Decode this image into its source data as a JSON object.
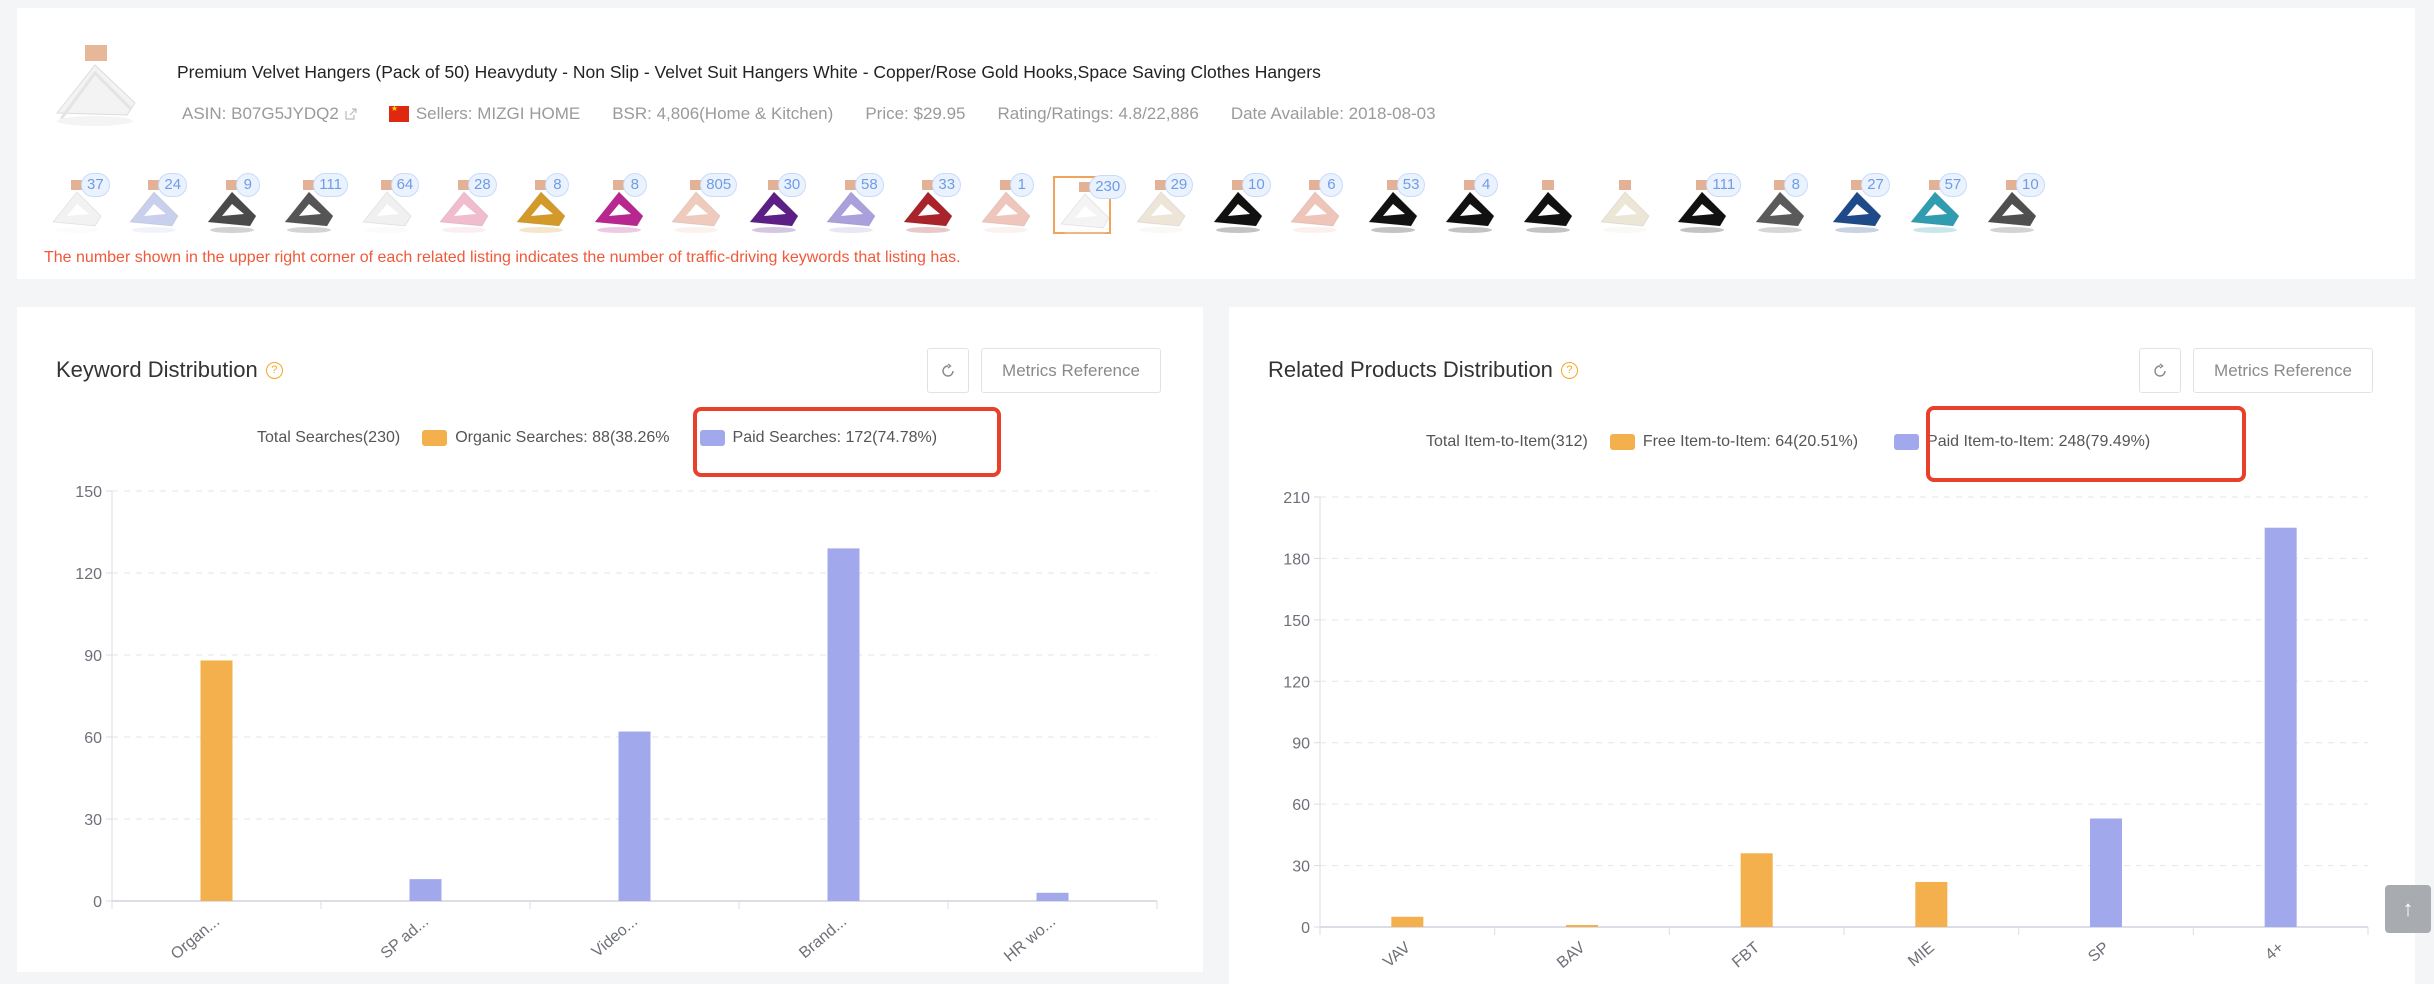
{
  "product": {
    "title": "Premium Velvet Hangers (Pack of 50) Heavyduty - Non Slip - Velvet Suit Hangers White - Copper/Rose Gold Hooks,Space Saving Clothes Hangers",
    "asin": "ASIN: B07G5JYDQ2",
    "sellers": "Sellers: MIZGI HOME",
    "bsr": "BSR: 4,806(Home & Kitchen)",
    "price": "Price: $29.95",
    "rating": "Rating/Ratings: 4.8/22,886",
    "date_available": "Date Available: 2018-08-03",
    "seller_flag": "china-flag-icon"
  },
  "related_listings": [
    {
      "count": "37",
      "color": "#f2f2f2"
    },
    {
      "count": "24",
      "color": "#c9d0ee"
    },
    {
      "count": "9",
      "color": "#4a4a4a"
    },
    {
      "count": "111",
      "color": "#555555"
    },
    {
      "count": "64",
      "color": "#f0f0f0"
    },
    {
      "count": "28",
      "color": "#f1bccd"
    },
    {
      "count": "8",
      "color": "#d39a2a"
    },
    {
      "count": "8",
      "color": "#b8278f"
    },
    {
      "count": "805",
      "color": "#efcbbd"
    },
    {
      "count": "30",
      "color": "#5b1f86"
    },
    {
      "count": "58",
      "color": "#a9a0dc"
    },
    {
      "count": "33",
      "color": "#a8232a"
    },
    {
      "count": "1",
      "color": "#efc6bb"
    },
    {
      "count": "230",
      "color": "#f4f4f4",
      "selected": true
    },
    {
      "count": "29",
      "color": "#ede6d8"
    },
    {
      "count": "10",
      "color": "#111111"
    },
    {
      "count": "6",
      "color": "#eec5b8"
    },
    {
      "count": "53",
      "color": "#111111"
    },
    {
      "count": "4",
      "color": "#111111"
    },
    {
      "count": null,
      "color": "#111111"
    },
    {
      "count": null,
      "color": "#ece6d6"
    },
    {
      "count": "111",
      "color": "#111111"
    },
    {
      "count": "8",
      "color": "#5a5a5a"
    },
    {
      "count": "27",
      "color": "#1f4a8a"
    },
    {
      "count": "57",
      "color": "#2f9cb0"
    },
    {
      "count": "10",
      "color": "#4f4f4f"
    }
  ],
  "note": "The number shown in the upper right corner of each related listing indicates the number of traffic-driving keywords that listing has.",
  "keyword_panel": {
    "title": "Keyword Distribution",
    "metrics_button": "Metrics Reference",
    "legend_total": "Total Searches(230)",
    "legend_organic": "Organic Searches: 88(38.26%",
    "legend_paid": "Paid Searches: 172(74.78%)"
  },
  "related_panel": {
    "title": "Related Products Distribution",
    "metrics_button": "Metrics Reference",
    "legend_total": "Total Item-to-Item(312)",
    "legend_free": "Free Item-to-Item: 64(20.51%)",
    "legend_paid": "Paid Item-to-Item: 248(79.49%)"
  },
  "colors": {
    "organic": "#f3b04c",
    "paid": "#a2a8ec",
    "highlight": "#e8402a",
    "note": "#f0593a"
  },
  "chart_data": [
    {
      "type": "bar",
      "title": "Keyword Distribution",
      "categories": [
        "Organ...",
        "SP ad...",
        "Video...",
        "Brand...",
        "HR wo..."
      ],
      "series": [
        {
          "name": "Organic Searches",
          "values": [
            88,
            0,
            0,
            0,
            0
          ]
        },
        {
          "name": "Paid Searches",
          "values": [
            0,
            8,
            62,
            129,
            3
          ]
        }
      ],
      "ylim": [
        0,
        150
      ],
      "yticks": [
        0,
        30,
        60,
        90,
        120,
        150
      ],
      "xlabel": "",
      "ylabel": "",
      "grid": true,
      "legend": "top-center"
    },
    {
      "type": "bar",
      "title": "Related Products Distribution",
      "categories": [
        "VAV",
        "BAV",
        "FBT",
        "MIE",
        "SP",
        "4+"
      ],
      "series": [
        {
          "name": "Free Item-to-Item",
          "values": [
            5,
            1,
            36,
            22,
            0,
            0
          ]
        },
        {
          "name": "Paid Item-to-Item",
          "values": [
            0,
            0,
            0,
            0,
            53,
            195
          ]
        }
      ],
      "ylim": [
        0,
        210
      ],
      "yticks": [
        0,
        30,
        60,
        90,
        120,
        150,
        180,
        210
      ],
      "xlabel": "",
      "ylabel": "",
      "grid": true,
      "legend": "top-center"
    }
  ]
}
